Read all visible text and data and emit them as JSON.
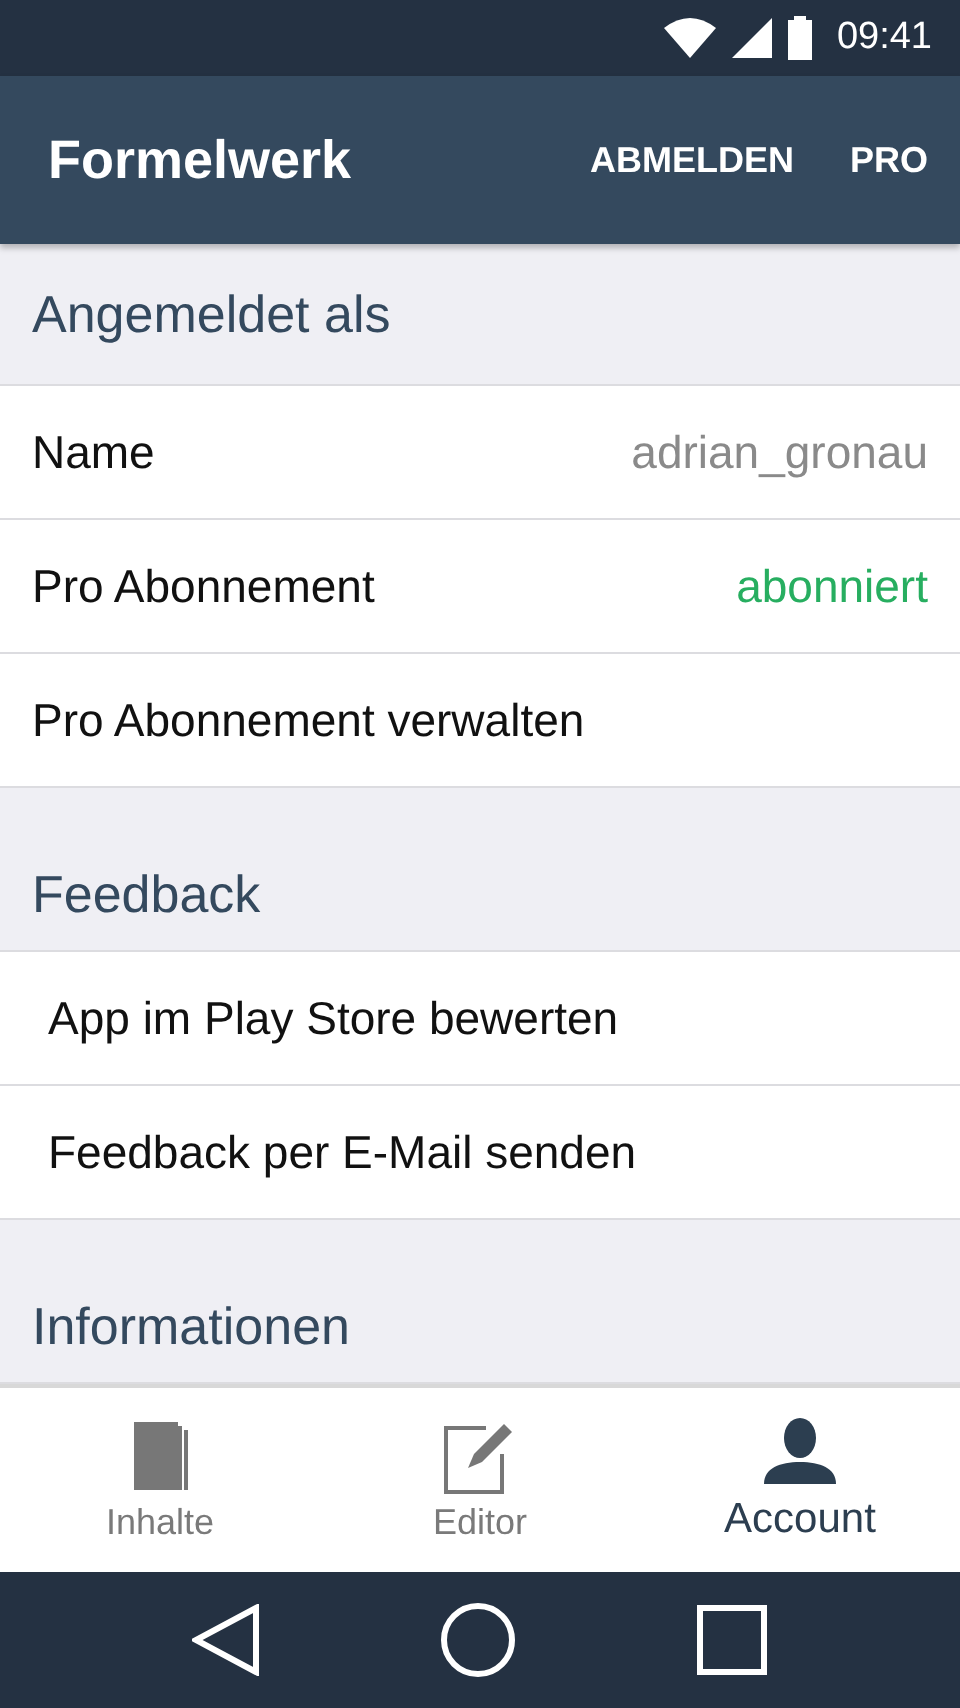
{
  "status_bar": {
    "time": "09:41"
  },
  "app_bar": {
    "title": "Formelwerk",
    "actions": [
      "ABMELDEN",
      "PRO"
    ]
  },
  "sections": [
    {
      "title": "Angemeldet als",
      "indent": false,
      "rows": [
        {
          "label": "Name",
          "value": "adrian_gronau",
          "color": "#8a8a8a"
        },
        {
          "label": "Pro Abonnement",
          "value": "abonniert",
          "color": "#27ae60"
        },
        {
          "label": "Pro Abonnement verwalten"
        }
      ]
    },
    {
      "title": "Feedback",
      "indent": true,
      "rows": [
        {
          "label": "App im Play Store bewerten"
        },
        {
          "label": "Feedback per E-Mail senden"
        }
      ]
    },
    {
      "title": "Informationen"
    }
  ],
  "bottom_nav": [
    {
      "label": "Inhalte",
      "kind": "book",
      "selected": false
    },
    {
      "label": "Editor",
      "kind": "edit",
      "selected": false
    },
    {
      "label": "Account",
      "kind": "person",
      "selected": true
    }
  ]
}
